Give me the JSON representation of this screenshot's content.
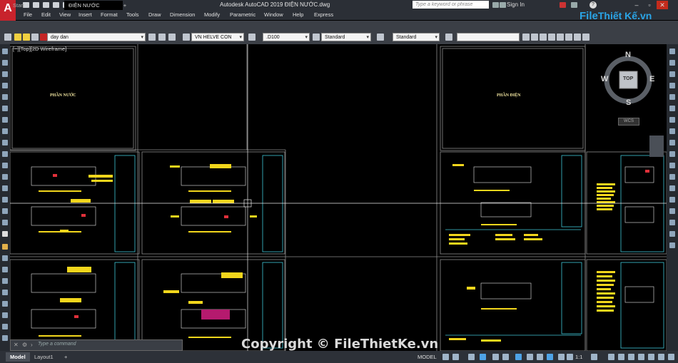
{
  "window": {
    "app_title": "Autodesk AutoCAD 2019    ĐIỆN NƯỚC.dwg",
    "search_placeholder": "Type a keyword or phrase",
    "sign_in": "Sign In",
    "help": "?"
  },
  "brand": {
    "part1": "File",
    "part2": "Thiết Kế.vn"
  },
  "menu": [
    "File",
    "Edit",
    "View",
    "Insert",
    "Format",
    "Tools",
    "Draw",
    "Dimension",
    "Modify",
    "Parametric",
    "Window",
    "Help",
    "Express"
  ],
  "tabs": {
    "start": "Start",
    "document": "ĐIỆN NƯỚC",
    "new": "+"
  },
  "properties": {
    "layer": "day dan",
    "text_style": "VN HELVE CON",
    "dim_style": ".D100",
    "table_style": "Standard",
    "mleader_style": "Standard"
  },
  "viewport": {
    "label": "[−][Top][2D Wireframe]"
  },
  "viewcube": {
    "north": "N",
    "south": "S",
    "east": "E",
    "west": "W",
    "face": "TOP",
    "wcs": "WCS"
  },
  "drawing_titles": {
    "water": "PHẦN NƯỚC",
    "electric": "PHẦN ĐIỆN"
  },
  "command": {
    "placeholder": "Type a command"
  },
  "layout_tabs": {
    "model": "Model",
    "layout1": "Layout1",
    "add": "+"
  },
  "status": {
    "mode": "MODEL",
    "scale": "1:1"
  },
  "watermark": "Copyright © FileThietKe.vn",
  "colors": {
    "accent": "#c8232c",
    "brand_blue": "#2aa4e6",
    "frame_line": "#8c8c8c",
    "detail_cyan": "#3fc6d6",
    "detail_yellow": "#f2d61c"
  }
}
